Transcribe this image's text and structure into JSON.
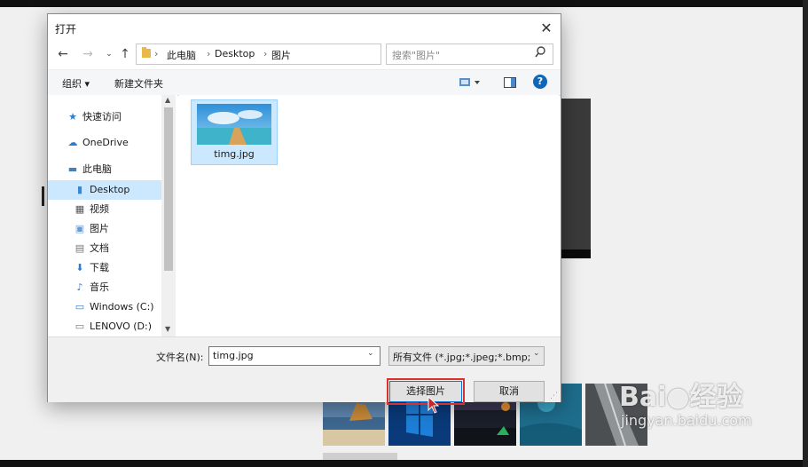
{
  "dialog": {
    "title": "打开",
    "breadcrumb": [
      "此电脑",
      "Desktop",
      "图片"
    ],
    "search_placeholder": "搜索\"图片\"",
    "toolbar": {
      "organize": "组织 ▾",
      "new_folder": "新建文件夹"
    },
    "nav_items": [
      "快速访问",
      "OneDrive",
      "此电脑",
      "Desktop",
      "视频",
      "图片",
      "文档",
      "下载",
      "音乐",
      "Windows (C:)",
      "LENOVO (D:)"
    ],
    "selected_nav": "Desktop",
    "files": [
      {
        "name": "timg.jpg"
      }
    ],
    "filename_label": "文件名(N):",
    "filename_value": "timg.jpg",
    "filetype_value": "所有文件 (*.jpg;*.jpeg;*.bmp;",
    "open_label": "选择图片",
    "cancel_label": "取消"
  },
  "watermark": {
    "brand": "Bai",
    "brand2": "经验",
    "url": "jingyan.baidu.com"
  },
  "icons": {
    "back": "arrow-left",
    "forward": "arrow-right",
    "up": "arrow-up",
    "refresh": "refresh",
    "search": "magnifier",
    "close": "close",
    "help": "question"
  },
  "colors": {
    "accent": "#0078d7",
    "selection": "#cce8ff",
    "highlight_border": "#d93030"
  }
}
